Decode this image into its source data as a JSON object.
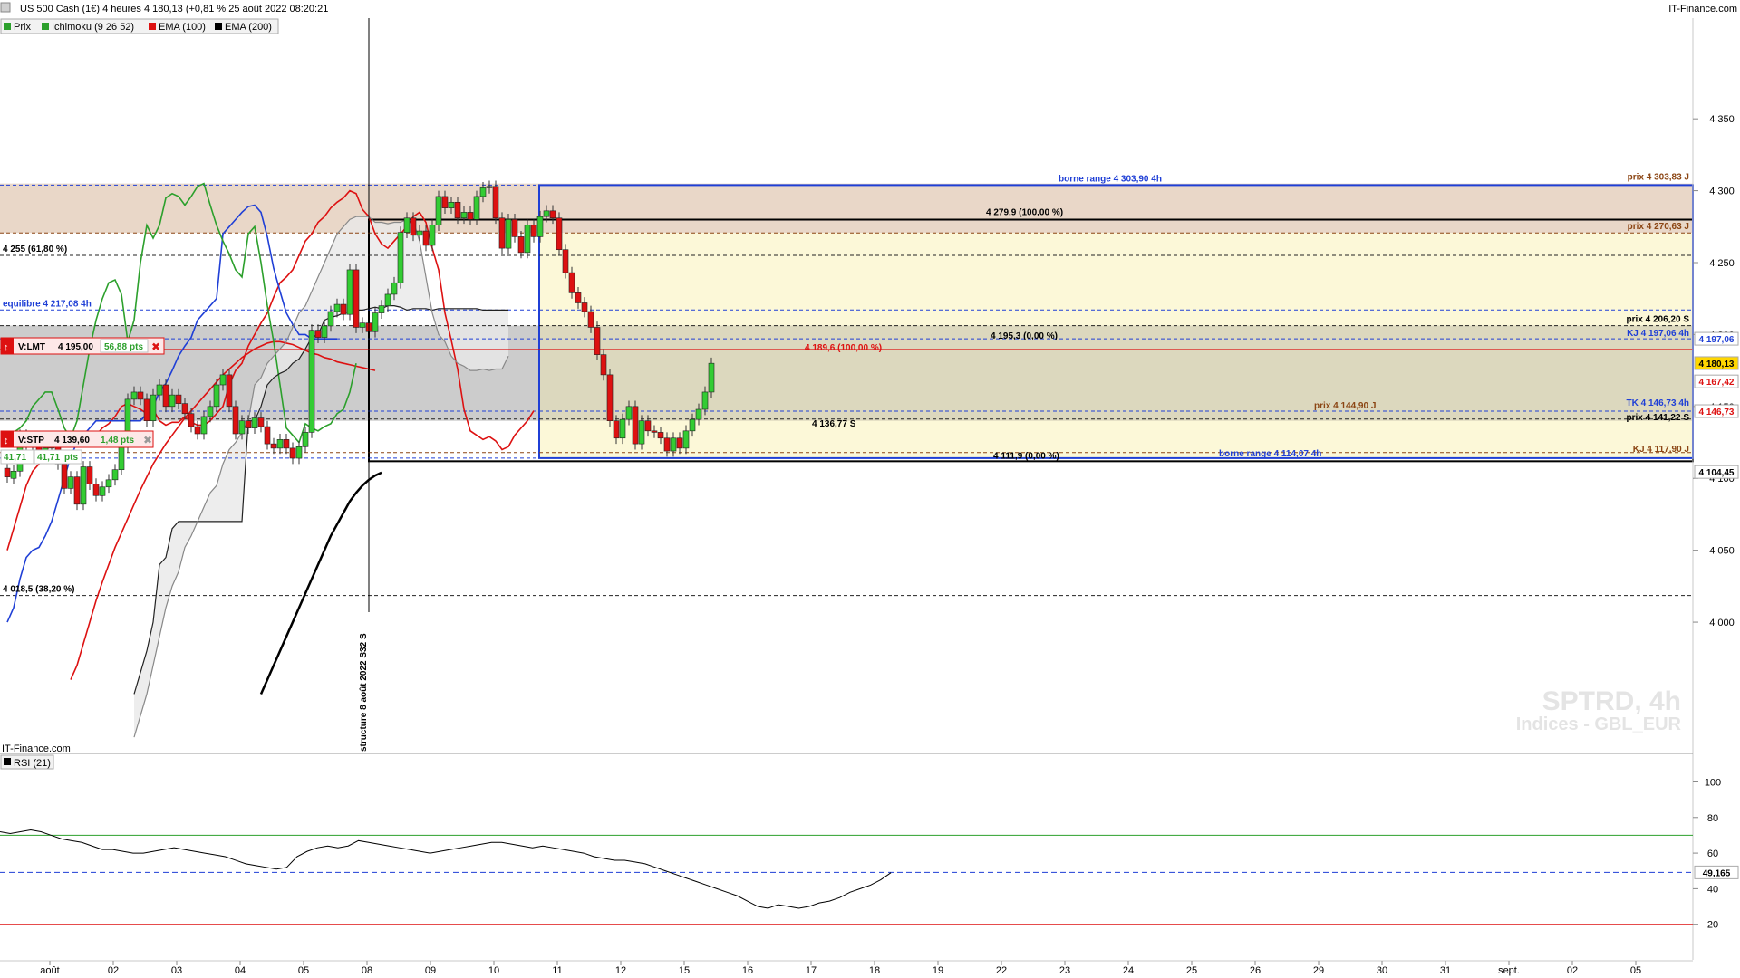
{
  "header": {
    "title": "US 500 Cash (1€) 4 heures 4 180,13 (+0,81 % 25 août 2022 08:20:21",
    "source": "IT-Finance.com",
    "legend": [
      {
        "label": "Prix",
        "color": "#2ca02c"
      },
      {
        "label": "Ichimoku (9 26 52)",
        "color": "#2ca02c"
      },
      {
        "label": "EMA (100)",
        "color": "#dd1111"
      },
      {
        "label": "EMA (200)",
        "color": "#000000"
      }
    ]
  },
  "watermark": {
    "symbol": "SPTRD, 4h",
    "market": "Indices - GBL_EUR",
    "source": "IT-Finance.com"
  },
  "orders": {
    "limit": {
      "label": "V:LMT",
      "price": "4 195,00",
      "pts": "56,88",
      "pts_unit": "pts",
      "value": 4195.0
    },
    "stop": {
      "label": "V:STP",
      "price": "4 139,60",
      "pts": "1,48",
      "pts_unit": "pts",
      "value": 4139.6
    },
    "sub_left": "41,71",
    "sub_mid": "41,71",
    "sub_unit": "pts"
  },
  "price_badges": [
    {
      "text": "4 180,13",
      "value": 4180.13,
      "bg": "#ffd700",
      "fg": "#000000"
    },
    {
      "text": "4 167,42",
      "value": 4167.42,
      "bg": "#ffffff",
      "fg": "#dd1111"
    },
    {
      "text": "4 197,06",
      "value": 4197.06,
      "bg": "#ffffff",
      "fg": "#1f3fd6"
    },
    {
      "text": "4 146,73",
      "value": 4146.73,
      "bg": "#ffffff",
      "fg": "#dd1111"
    },
    {
      "text": "4 104,45",
      "value": 4104.45,
      "bg": "#ffffff",
      "fg": "#000000"
    },
    {
      "text": "49,165",
      "value": 49.165,
      "bg": "#ffffff",
      "fg": "#000000",
      "pane": "rsi"
    }
  ],
  "annotations": {
    "borne_high": "borne range 4 303,90 4h",
    "borne_low": "borne range 4 114,07 4h",
    "prix_303": "prix 4 303,83 J",
    "prix_270": "prix 4 270,63 J",
    "prix_206": "prix 4 206,20 S",
    "kj_197": "KJ 4 197,06 4h",
    "tk_146": "TK 4 146,73 4h",
    "prix_141": "prix 4 141,22 S",
    "prix_144": "prix 4 144,90 J",
    "kj_117": "KJ 4 117,90 J",
    "fib_255": "4 255 (61,80 %)",
    "fib_018": "4 018,5 (38,20 %)",
    "equilibre": "equilibre 4 217,08 4h",
    "fib_279": "4 279,9 (100,00 %)",
    "fib_195": "4 195,3 (0,00 %)",
    "fib_189": "4 189,6 (100,00 %)",
    "fib_111": "4 111,9 (0,00 %)",
    "fib_136": "4 136,77 S",
    "structure": "structure 8 août 2022 S32 S"
  },
  "rsi": {
    "label": "RSI (21)",
    "last": 49.165,
    "overbought": 70,
    "oversold": 20,
    "mid": 49.165
  },
  "chart_data": {
    "type": "candlestick",
    "symbol": "US 500 Cash",
    "timeframe": "4h",
    "y_axis": {
      "min": 3910,
      "max": 4420,
      "ticks": [
        4000,
        4050,
        4100,
        4150,
        4200,
        4250,
        4300,
        4350
      ],
      "tick_labels": [
        "4 000",
        "4 050",
        "4 100",
        "4 150",
        "4 200",
        "4 250",
        "4 300",
        "4 350"
      ]
    },
    "x_axis": {
      "labels": [
        "août",
        "02",
        "03",
        "04",
        "05",
        "08",
        "09",
        "10",
        "11",
        "12",
        "15",
        "16",
        "17",
        "18",
        "19",
        "22",
        "23",
        "24",
        "25",
        "26",
        "29",
        "30",
        "31",
        "sept.",
        "02",
        "05"
      ],
      "label_index": [
        0,
        8,
        16,
        24,
        32,
        40,
        48,
        56,
        64,
        72,
        80,
        88,
        96,
        104,
        112,
        120,
        128,
        136,
        144,
        152,
        160,
        168,
        176,
        184,
        192,
        200
      ]
    },
    "candles": [
      [
        4107,
        4101
      ],
      [
        4100,
        4105
      ],
      [
        4105,
        4130
      ],
      [
        4130,
        4122
      ],
      [
        4122,
        4126
      ],
      [
        4126,
        4115
      ],
      [
        4115,
        4121
      ],
      [
        4121,
        4128
      ],
      [
        4128,
        4110
      ],
      [
        4110,
        4093
      ],
      [
        4093,
        4101
      ],
      [
        4101,
        4082
      ],
      [
        4082,
        4108
      ],
      [
        4108,
        4096
      ],
      [
        4096,
        4088
      ],
      [
        4088,
        4094
      ],
      [
        4094,
        4099
      ],
      [
        4099,
        4106
      ],
      [
        4106,
        4122
      ],
      [
        4122,
        4155
      ],
      [
        4155,
        4160
      ],
      [
        4160,
        4155
      ],
      [
        4155,
        4140
      ],
      [
        4140,
        4158
      ],
      [
        4158,
        4165
      ],
      [
        4165,
        4150
      ],
      [
        4150,
        4158
      ],
      [
        4158,
        4152
      ],
      [
        4152,
        4145
      ],
      [
        4145,
        4136
      ],
      [
        4136,
        4131
      ],
      [
        4131,
        4143
      ],
      [
        4143,
        4150
      ],
      [
        4150,
        4165
      ],
      [
        4165,
        4172
      ],
      [
        4172,
        4150
      ],
      [
        4150,
        4131
      ],
      [
        4131,
        4140
      ],
      [
        4140,
        4135
      ],
      [
        4135,
        4142
      ],
      [
        4142,
        4136
      ],
      [
        4136,
        4124
      ],
      [
        4124,
        4121
      ],
      [
        4121,
        4127
      ],
      [
        4127,
        4121
      ],
      [
        4121,
        4114
      ],
      [
        4114,
        4122
      ],
      [
        4122,
        4132
      ],
      [
        4132,
        4203
      ],
      [
        4203,
        4198
      ],
      [
        4198,
        4206
      ],
      [
        4206,
        4216
      ],
      [
        4216,
        4221
      ],
      [
        4221,
        4214
      ],
      [
        4214,
        4245
      ],
      [
        4245,
        4205
      ],
      [
        4205,
        4208
      ],
      [
        4208,
        4202
      ],
      [
        4202,
        4215
      ],
      [
        4215,
        4220
      ],
      [
        4220,
        4228
      ],
      [
        4228,
        4236
      ],
      [
        4236,
        4271
      ],
      [
        4271,
        4281
      ],
      [
        4281,
        4269
      ],
      [
        4269,
        4272
      ],
      [
        4272,
        4262
      ],
      [
        4262,
        4276
      ],
      [
        4276,
        4296
      ],
      [
        4296,
        4288
      ],
      [
        4288,
        4292
      ],
      [
        4292,
        4281
      ],
      [
        4281,
        4285
      ],
      [
        4285,
        4280
      ],
      [
        4280,
        4296
      ],
      [
        4296,
        4302
      ],
      [
        4302,
        4303
      ],
      [
        4303,
        4281
      ],
      [
        4281,
        4260
      ],
      [
        4260,
        4280
      ],
      [
        4280,
        4268
      ],
      [
        4268,
        4257
      ],
      [
        4257,
        4276
      ],
      [
        4276,
        4268
      ],
      [
        4268,
        4282
      ],
      [
        4282,
        4286
      ],
      [
        4286,
        4281
      ],
      [
        4281,
        4259
      ],
      [
        4259,
        4243
      ],
      [
        4243,
        4229
      ],
      [
        4229,
        4222
      ],
      [
        4222,
        4216
      ],
      [
        4216,
        4205
      ],
      [
        4205,
        4186
      ],
      [
        4186,
        4172
      ],
      [
        4172,
        4140
      ],
      [
        4140,
        4128
      ],
      [
        4128,
        4141
      ],
      [
        4141,
        4150
      ],
      [
        4150,
        4124
      ],
      [
        4124,
        4140
      ],
      [
        4140,
        4133
      ],
      [
        4133,
        4132
      ],
      [
        4132,
        4128
      ],
      [
        4128,
        4119
      ],
      [
        4119,
        4128
      ],
      [
        4128,
        4121
      ],
      [
        4121,
        4133
      ],
      [
        4133,
        4141
      ],
      [
        4141,
        4148
      ],
      [
        4148,
        4160
      ],
      [
        4160,
        4180
      ]
    ],
    "series": [
      {
        "name": "EMA (100)",
        "color": "#dd1111",
        "from": 10,
        "values": [
          3960,
          3970,
          3985,
          4000,
          4015,
          4028,
          4040,
          4052,
          4062,
          4072,
          4082,
          4092,
          4101,
          4110,
          4117,
          4124,
          4130,
          4136,
          4142,
          4147,
          4152,
          4157,
          4162,
          4167,
          4172,
          4176,
          4180,
          4184,
          4187,
          4190,
          4192,
          4194,
          4195,
          4195,
          4194,
          4193,
          4191,
          4189,
          4187,
          4186,
          4184,
          4183,
          4181,
          4180,
          4179,
          4178,
          4177,
          4176,
          4175
        ]
      },
      {
        "name": "EMA (200)",
        "color": "#000000",
        "from": 40,
        "values": [
          3950,
          3960,
          3970,
          3980,
          3990,
          4000,
          4010,
          4020,
          4030,
          4040,
          4050,
          4060,
          4068,
          4076,
          4084,
          4090,
          4095,
          4099,
          4102,
          4104
        ]
      },
      {
        "name": "Tenkan",
        "color": "#dd1111",
        "from": 0,
        "values": [
          4050,
          4065,
          4080,
          4095,
          4105,
          4110,
          4118,
          4125,
          4128,
          4130,
          4128,
          4125,
          4125,
          4126,
          4130,
          4135,
          4138,
          4143,
          4150,
          4152,
          4150,
          4148,
          4145,
          4148,
          4140,
          4137,
          4139,
          4139,
          4143,
          4139,
          4137,
          4137,
          4140,
          4145,
          4150,
          4165,
          4175,
          4180,
          4192,
          4200,
          4208,
          4215,
          4226,
          4236,
          4240,
          4245,
          4255,
          4265,
          4270,
          4278,
          4282,
          4288,
          4292,
          4295,
          4300,
          4298,
          4287,
          4282,
          4270,
          4263,
          4260,
          4265,
          4270,
          4275,
          4282,
          4285,
          4278,
          4260,
          4245,
          4215,
          4196,
          4176,
          4148,
          4133,
          4130,
          4127,
          4129,
          4126,
          4120,
          4122,
          4130,
          4135,
          4140,
          4147
        ]
      },
      {
        "name": "Kijun",
        "color": "#1f3fd6",
        "from": 0,
        "values": [
          4000,
          4010,
          4030,
          4045,
          4050,
          4052,
          4060,
          4070,
          4085,
          4100,
          4115,
          4125,
          4130,
          4135,
          4140,
          4140,
          4140,
          4140,
          4140,
          4140,
          4140,
          4140,
          4145,
          4150,
          4160,
          4166,
          4175,
          4185,
          4192,
          4198,
          4210,
          4215,
          4220,
          4225,
          4270,
          4275,
          4280,
          4285,
          4289,
          4290,
          4285,
          4268,
          4246,
          4230,
          4215,
          4207,
          4200,
          4200,
          4197,
          4197,
          4197,
          4197,
          4197
        ]
      },
      {
        "name": "Chikou",
        "color": "#2ca02c",
        "from": 0,
        "values": [
          4130,
          4132,
          4135,
          4140,
          4150,
          4155,
          4160,
          4160,
          4148,
          4135,
          4128,
          4140,
          4165,
          4190,
          4210,
          4225,
          4236,
          4238,
          4228,
          4195,
          4210,
          4250,
          4276,
          4267,
          4276,
          4295,
          4298,
          4296,
          4290,
          4296,
          4303,
          4305,
          4290,
          4276,
          4265,
          4256,
          4245,
          4240,
          4270,
          4275,
          4250,
          4220,
          4195,
          4165,
          4135,
          4130,
          4125,
          4138,
          4135,
          4133,
          4136,
          4138,
          4145,
          4148,
          4160,
          4180
        ]
      },
      {
        "name": "SSA",
        "color": "#222222",
        "from": 20,
        "values": [
          3950,
          3965,
          3980,
          4000,
          4040,
          4045,
          4065,
          4070,
          4070,
          4070,
          4070,
          4070,
          4070,
          4070,
          4070,
          4070,
          4070,
          4070,
          4140,
          4140,
          4150,
          4165,
          4170,
          4173,
          4175,
          4180,
          4183,
          4190,
          4198,
          4200,
          4210,
          4212,
          4213,
          4215,
          4216,
          4217,
          4217,
          4218,
          4219,
          4218,
          4220,
          4220,
          4219,
          4217,
          4218,
          4218,
          4218,
          4217,
          4218,
          4218,
          4218,
          4218,
          4218,
          4218,
          4218,
          4217,
          4217,
          4217,
          4217,
          4217
        ]
      },
      {
        "name": "SSB",
        "color": "#888888",
        "from": 20,
        "values": [
          3920,
          3935,
          3950,
          3970,
          3990,
          4010,
          4025,
          4035,
          4052,
          4060,
          4070,
          4080,
          4090,
          4095,
          4110,
          4120,
          4125,
          4132,
          4140,
          4165,
          4170,
          4180,
          4185,
          4190,
          4195,
          4205,
          4215,
          4220,
          4230,
          4240,
          4250,
          4260,
          4270,
          4275,
          4280,
          4282,
          4282,
          4282,
          4278,
          4278,
          4277,
          4278,
          4278,
          4280,
          4279,
          4265,
          4240,
          4215,
          4200,
          4195,
          4185,
          4180,
          4178,
          4175,
          4175,
          4176,
          4175,
          4176,
          4176,
          4185
        ]
      }
    ],
    "levels": [
      {
        "value": 4303.9,
        "color": "#1f3fd6"
      },
      {
        "value": 4270.63,
        "color": "#8b4513"
      },
      {
        "value": 4255,
        "color": "#222222"
      },
      {
        "value": 4217.08,
        "color": "#1f3fd6"
      },
      {
        "value": 4206.2,
        "color": "#222222"
      },
      {
        "value": 4197.06,
        "color": "#1f3fd6"
      },
      {
        "value": 4189.6,
        "color": "#dd1111"
      },
      {
        "value": 4146.73,
        "color": "#1f3fd6"
      },
      {
        "value": 4141.22,
        "color": "#222222"
      },
      {
        "value": 4117.9,
        "color": "#8b4513"
      },
      {
        "value": 4114.07,
        "color": "#1f3fd6"
      },
      {
        "value": 4018.5,
        "color": "#222222"
      }
    ],
    "rsi_values": [
      72,
      71,
      72,
      73,
      72,
      70,
      68,
      67,
      66,
      64,
      62,
      62,
      61,
      60,
      60,
      61,
      62,
      63,
      62,
      61,
      60,
      59,
      58,
      56,
      54,
      53,
      52,
      51,
      52,
      58,
      61,
      63,
      64,
      63,
      64,
      67,
      66,
      65,
      64,
      63,
      62,
      61,
      60,
      61,
      62,
      63,
      64,
      65,
      66,
      66,
      65,
      64,
      63,
      64,
      63,
      62,
      61,
      60,
      58,
      57,
      56,
      56,
      55,
      54,
      52,
      50,
      48,
      46,
      44,
      42,
      40,
      38,
      36,
      33,
      30,
      29,
      31,
      30,
      29,
      30,
      32,
      33,
      35,
      38,
      40,
      42,
      45,
      49
    ]
  }
}
